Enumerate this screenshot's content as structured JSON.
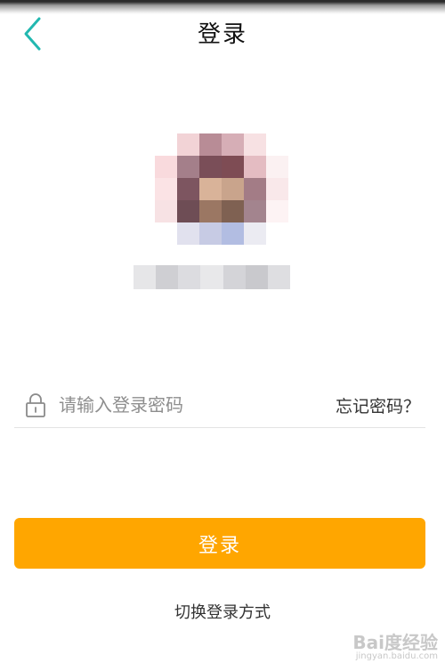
{
  "header": {
    "title": "登录",
    "back_icon": "chevron-left-icon",
    "accent_color": "#22b8b0"
  },
  "profile": {
    "avatar_icon": "pixelated-avatar"
  },
  "password_field": {
    "placeholder": "请输入登录密码",
    "value": "",
    "icon": "lock-icon",
    "forgot_label": "忘记密码？"
  },
  "actions": {
    "login_label": "登录",
    "login_color": "#ffa600",
    "switch_label": "切换登录方式"
  },
  "watermark": {
    "main": "Bai度经验",
    "sub": "jingyan.baidu.com"
  }
}
